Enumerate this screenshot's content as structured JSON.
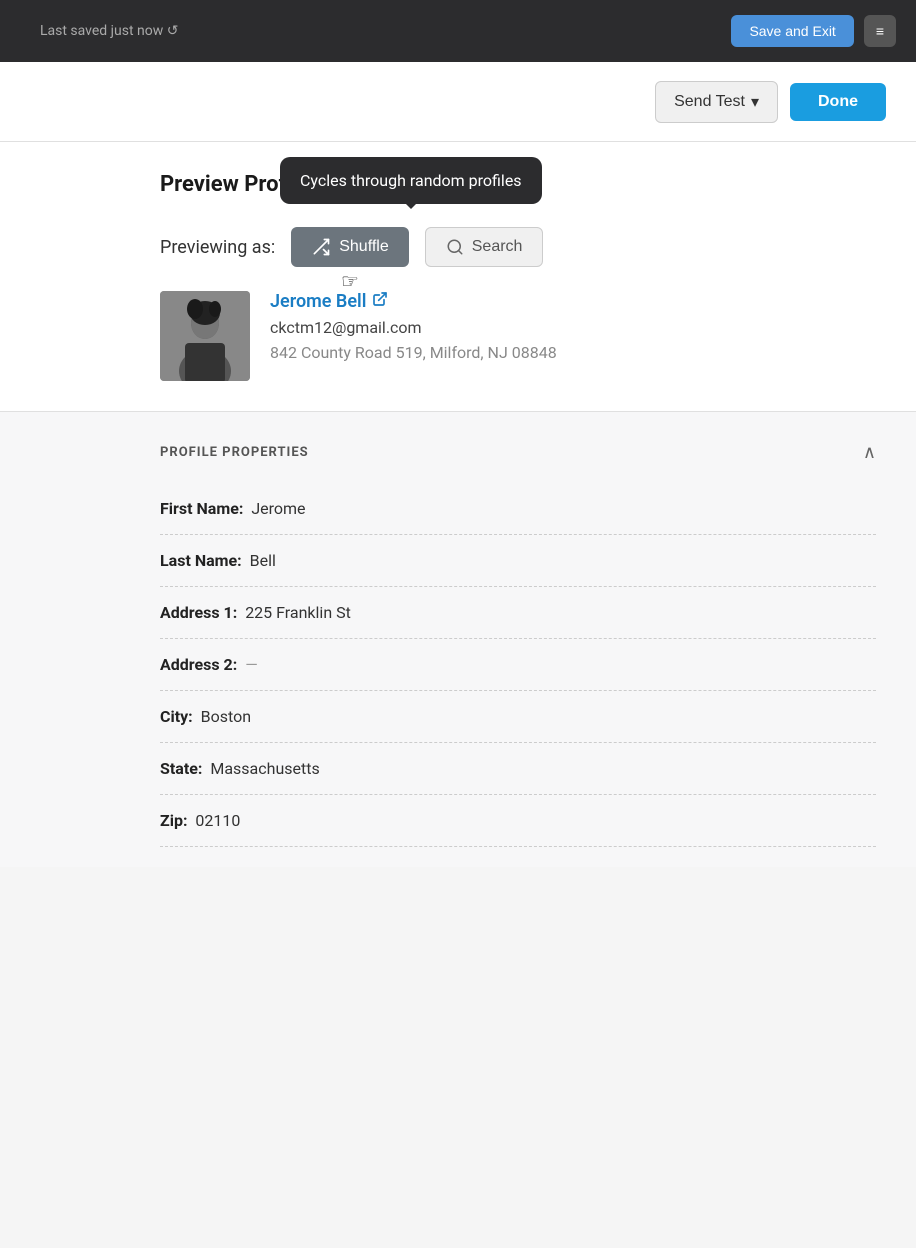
{
  "topBar": {
    "savedText": "Last saved just now  ↺",
    "saveExitLabel": "Save and Exit",
    "menuIconLabel": "≡"
  },
  "header": {
    "sendTestLabel": "Send Test",
    "sendTestDropdownIcon": "▾",
    "doneLabel": "Done"
  },
  "preview": {
    "title": "Preview Profile Info",
    "tooltip": "Cycles through random profiles",
    "previewingLabel": "Previewing as:",
    "shuffleLabel": "Shuffle",
    "shuffleIcon": "🔀",
    "searchLabel": "Search",
    "searchIcon": "🔍",
    "profile": {
      "name": "Jerome Bell",
      "email": "ckctm12@gmail.com",
      "address": "842 County Road 519, Milford, NJ 08848"
    }
  },
  "properties": {
    "sectionTitle": "PROFILE PROPERTIES",
    "collapseIcon": "∧",
    "fields": [
      {
        "label": "First Name:",
        "value": "Jerome",
        "empty": false
      },
      {
        "label": "Last Name:",
        "value": "Bell",
        "empty": false
      },
      {
        "label": "Address 1:",
        "value": "225 Franklin St",
        "empty": false
      },
      {
        "label": "Address 2:",
        "value": "—",
        "empty": true
      },
      {
        "label": "City:",
        "value": "Boston",
        "empty": false
      },
      {
        "label": "State:",
        "value": "Massachusetts",
        "empty": false
      },
      {
        "label": "Zip:",
        "value": "02110",
        "empty": false
      }
    ]
  }
}
